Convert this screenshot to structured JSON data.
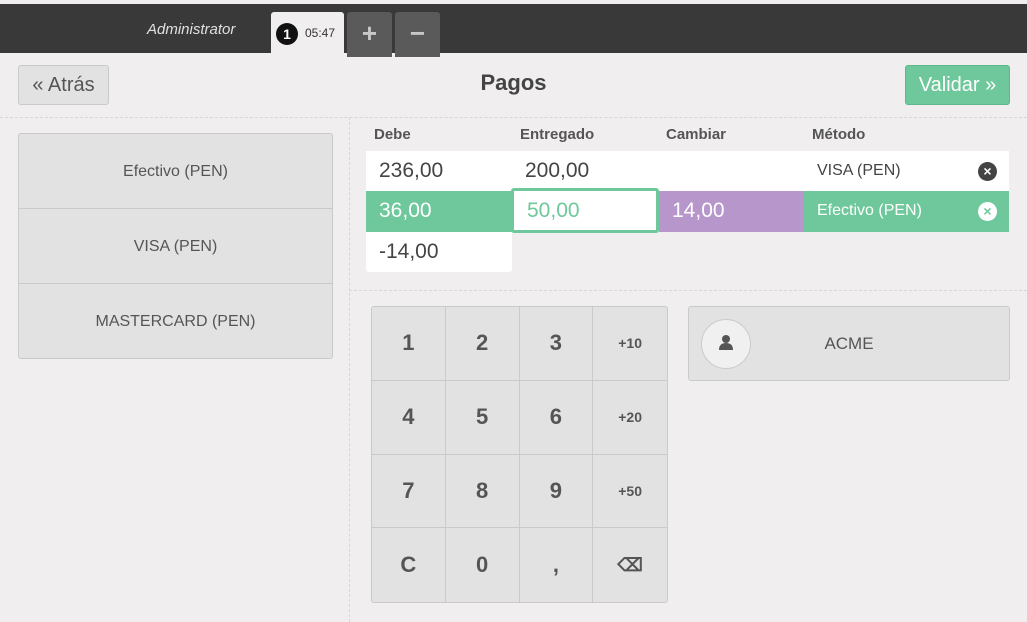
{
  "topbar": {
    "user": "Administrator",
    "order_number": "1",
    "order_time": "05:47",
    "add_label": "+",
    "remove_label": "−"
  },
  "header": {
    "back_label": "« Atrás",
    "title": "Pagos",
    "validate_label": "Validar »"
  },
  "payment_methods": [
    "Efectivo (PEN)",
    "VISA (PEN)",
    "MASTERCARD (PEN)"
  ],
  "paymentlines": {
    "columns": [
      "Debe",
      "Entregado",
      "Cambiar",
      "Método"
    ],
    "rows": [
      {
        "due": "236,00",
        "tendered": "200,00",
        "change": "",
        "method": "VISA (PEN)"
      },
      {
        "due": "36,00",
        "tendered": "50,00",
        "change": "14,00",
        "method": "Efectivo (PEN)"
      },
      {
        "due": "-14,00"
      }
    ]
  },
  "numpad": {
    "keys": [
      "1",
      "2",
      "3",
      "+10",
      "4",
      "5",
      "6",
      "+20",
      "7",
      "8",
      "9",
      "+50",
      "C",
      "0",
      ",",
      "⌫"
    ]
  },
  "customer": {
    "name": "ACME"
  },
  "colors": {
    "accent": "#6ec89b",
    "change": "#b797cb",
    "topbar": "#393939"
  }
}
